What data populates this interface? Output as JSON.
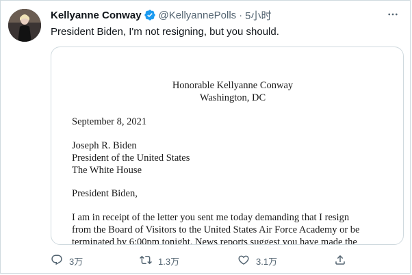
{
  "author": {
    "name": "Kellyanne Conway",
    "handle": "@KellyannePolls",
    "separator": "·",
    "time": "5小时"
  },
  "tweet": {
    "text": "President Biden, I'm not resigning, but you should."
  },
  "letter": {
    "heading_name": "Honorable Kellyanne Conway",
    "heading_location": "Washington, DC",
    "date": "September 8, 2021",
    "recipient": [
      "Joseph R. Biden",
      "President of the United States",
      "The White House"
    ],
    "salutation": "President Biden,",
    "body": [
      "I am in receipt of the letter you sent me today demanding that I resign",
      "from the Board of Visitors to the United States Air Force Academy or be",
      "terminated by 6:00pm tonight. News reports suggest you have made the"
    ]
  },
  "actions": {
    "reply_count": "3万",
    "retweet_count": "1.3万",
    "like_count": "3.1万"
  },
  "colors": {
    "verified": "#1d9bf0",
    "muted_text": "#536471",
    "border": "#cfd9de"
  }
}
